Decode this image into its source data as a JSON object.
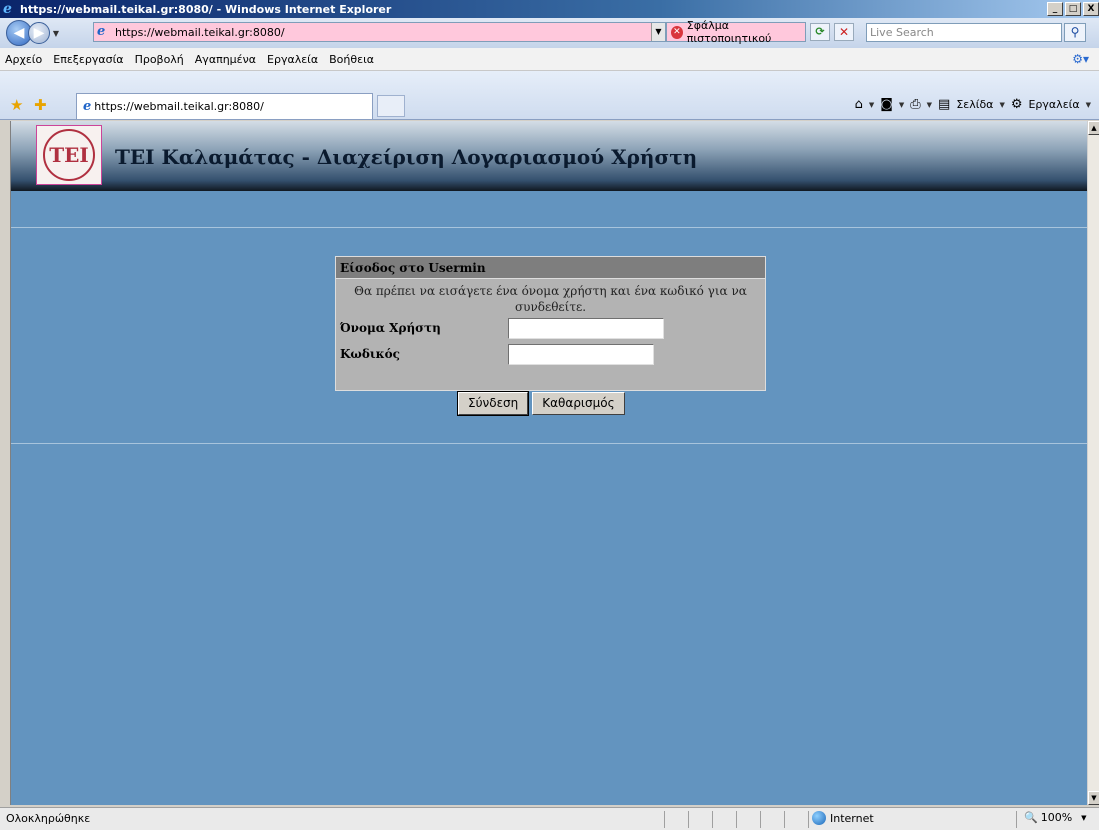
{
  "window": {
    "title": "https://webmail.teikal.gr:8080/ - Windows Internet Explorer",
    "minimize": "_",
    "maximize": "□",
    "close": "X"
  },
  "address_bar": {
    "url": "https://webmail.teikal.gr:8080/",
    "cert_error": "Σφάλμα πιστοποιητικού",
    "search_placeholder": "Live Search"
  },
  "menu": {
    "items": [
      "Αρχείο",
      "Επεξεργασία",
      "Προβολή",
      "Αγαπημένα",
      "Εργαλεία",
      "Βοήθεια"
    ]
  },
  "tab": {
    "label": "https://webmail.teikal.gr:8080/"
  },
  "command_bar": {
    "page_label": "Σελίδα",
    "tools_label": "Εργαλεία"
  },
  "page": {
    "site_title": "ΤΕΙ Καλαμάτας - Διαχείριση Λογαριασμού Χρήστη",
    "login": {
      "heading": "Είσοδος στο Usermin",
      "message": "Θα πρέπει να εισάγετε ένα όνομα χρήστη και ένα κωδικό για να συνδεθείτε.",
      "username_label": "Όνομα Χρήστη",
      "username_value": "",
      "password_label": "Κωδικός",
      "password_value": "",
      "login_button": "Σύνδεση",
      "clear_button": "Καθαρισμός"
    }
  },
  "status_bar": {
    "status": "Ολοκληρώθηκε",
    "zone": "Internet",
    "zoom": "100%"
  },
  "colors": {
    "page_background": "#6394bf",
    "login_header": "#7e7e7e",
    "login_body": "#b3b3b3",
    "cert_error_bg": "#ffc8dc"
  }
}
